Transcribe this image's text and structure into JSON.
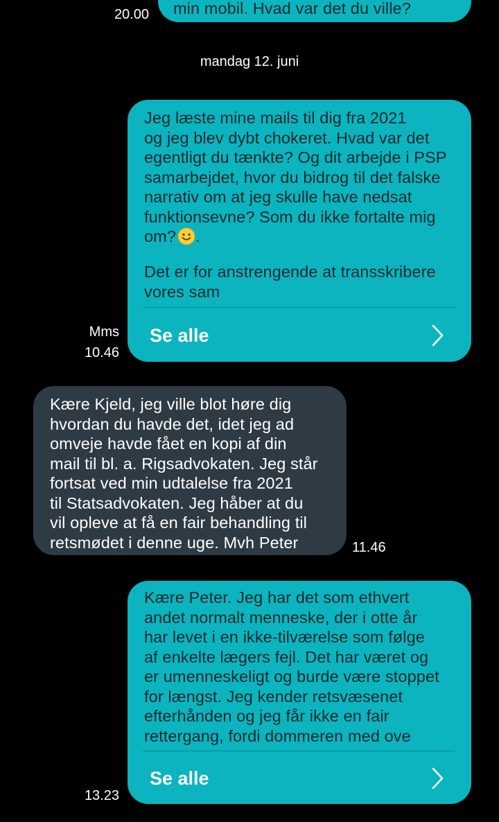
{
  "top_partial": {
    "time": "20.00",
    "text": "min mobil. Hvad var det du ville?"
  },
  "date_separator": "mandag 12. juni",
  "messages": [
    {
      "type": "sent",
      "label": "Mms",
      "time": "10.46",
      "text_main": "Jeg læste mine mails til dig fra 2021\nog jeg blev dybt chokeret. Hvad var det\negentligt du tænkte?  Og dit arbejde i PSP\nsamarbejdet, hvor du bidrog til det falske\nnarrativ om at jeg skulle have nedsat\nfunktionsevne? Som du ikke fortalte mig\nom?",
      "emoji": "slightly-smiling-face",
      "text_tail": "Det er for anstrengende at transskribere\nvores sam",
      "see_all": "Se alle"
    },
    {
      "type": "received",
      "time": "11.46",
      "text": "Kære Kjeld, jeg ville blot høre dig\nhvordan du havde det, idet jeg ad\nomveje havde fået en kopi af din\nmail til bl. a. Rigsadvokaten. Jeg står\nfortsat ved min udtalelse fra 2021\ntil Statsadvokaten. Jeg håber at du\nvil opleve at få en fair behandling til\nretsmødet i denne uge. Mvh Peter"
    },
    {
      "type": "sent",
      "time": "13.23",
      "text": "Kære Peter. Jeg har det som ethvert\nandet normalt menneske, der i otte år\nhar levet i en ikke-tilværelse som følge\naf enkelte lægers fejl. Det har været og\ner umenneskeligt og burde være stoppet\nfor længst. Jeg kender retsvæsenet\nefterhånden og jeg får ikke en fair\nrettergang, fordi dommeren med ove",
      "see_all": "Se alle"
    }
  ],
  "colors": {
    "background": "#000000",
    "sent_bubble": "#0bb4bf",
    "received_bubble": "#2e3a44",
    "text_light": "#ffffff"
  },
  "icons": {
    "chevron": "chevron-right-icon",
    "emoji": "smiling-face-icon"
  }
}
